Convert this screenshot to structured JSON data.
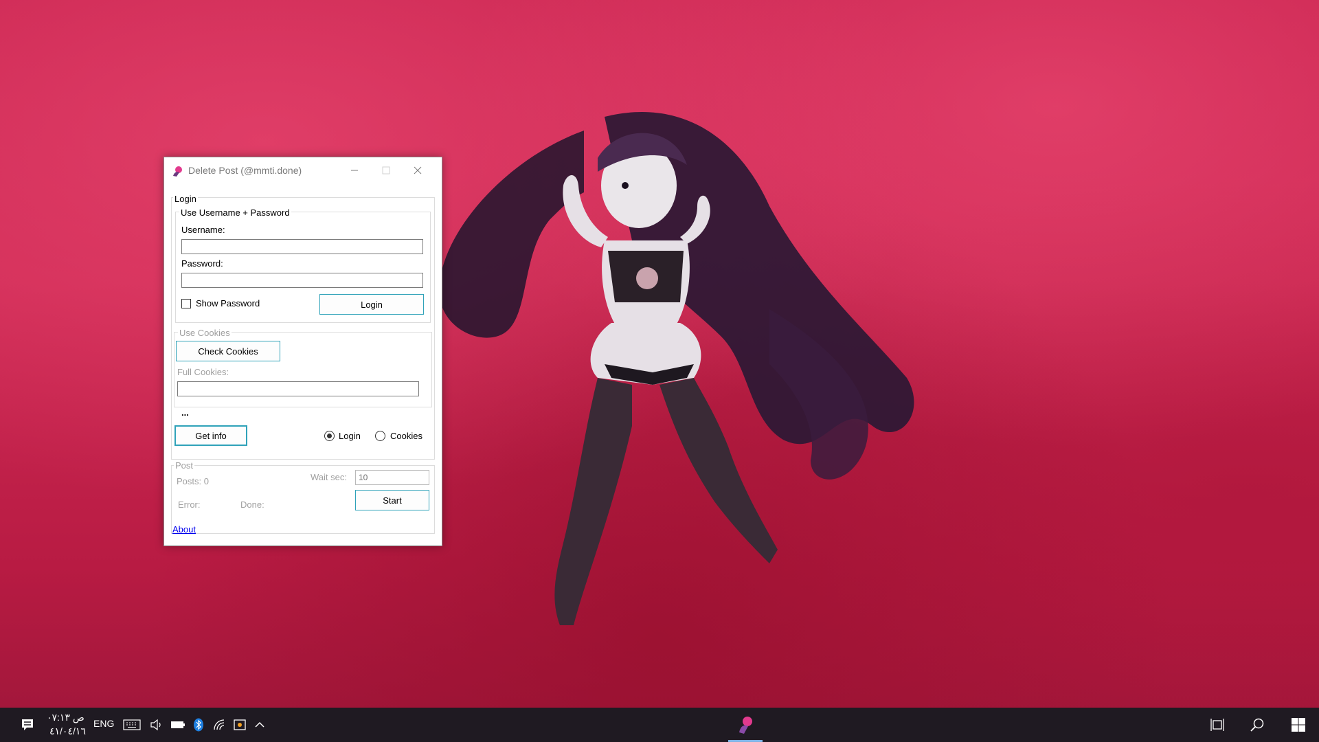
{
  "window": {
    "title": "Delete Post (@mmti.done)",
    "login_group": {
      "label": "Login",
      "userpass_group": {
        "label": "Use Username + Password",
        "username_label": "Username:",
        "username_value": "",
        "password_label": "Password:",
        "password_value": "",
        "show_password_label": "Show Password",
        "show_password_checked": false,
        "login_button": "Login"
      },
      "cookies_group": {
        "label": "Use Cookies",
        "check_cookies_button": "Check Cookies",
        "full_cookies_label": "Full Cookies:",
        "full_cookies_value": ""
      },
      "status_text": "...",
      "get_info_button": "Get info",
      "radio_login_label": "Login",
      "radio_cookies_label": "Cookies",
      "selected_mode": "Login"
    },
    "post_group": {
      "label": "Post",
      "posts_label": "Posts: 0",
      "wait_label": "Wait sec:",
      "wait_value": "10",
      "error_label": "Error:",
      "done_label": "Done:",
      "start_button": "Start"
    },
    "about_link": "About"
  },
  "taskbar": {
    "time": "ص ٠٧:١٣",
    "date": "٤١/٠٤/١٦",
    "language": "ENG"
  },
  "colors": {
    "button_border": "#2fa2b9",
    "wallpaper": "#c8234f",
    "taskbar": "#1f1a22"
  }
}
